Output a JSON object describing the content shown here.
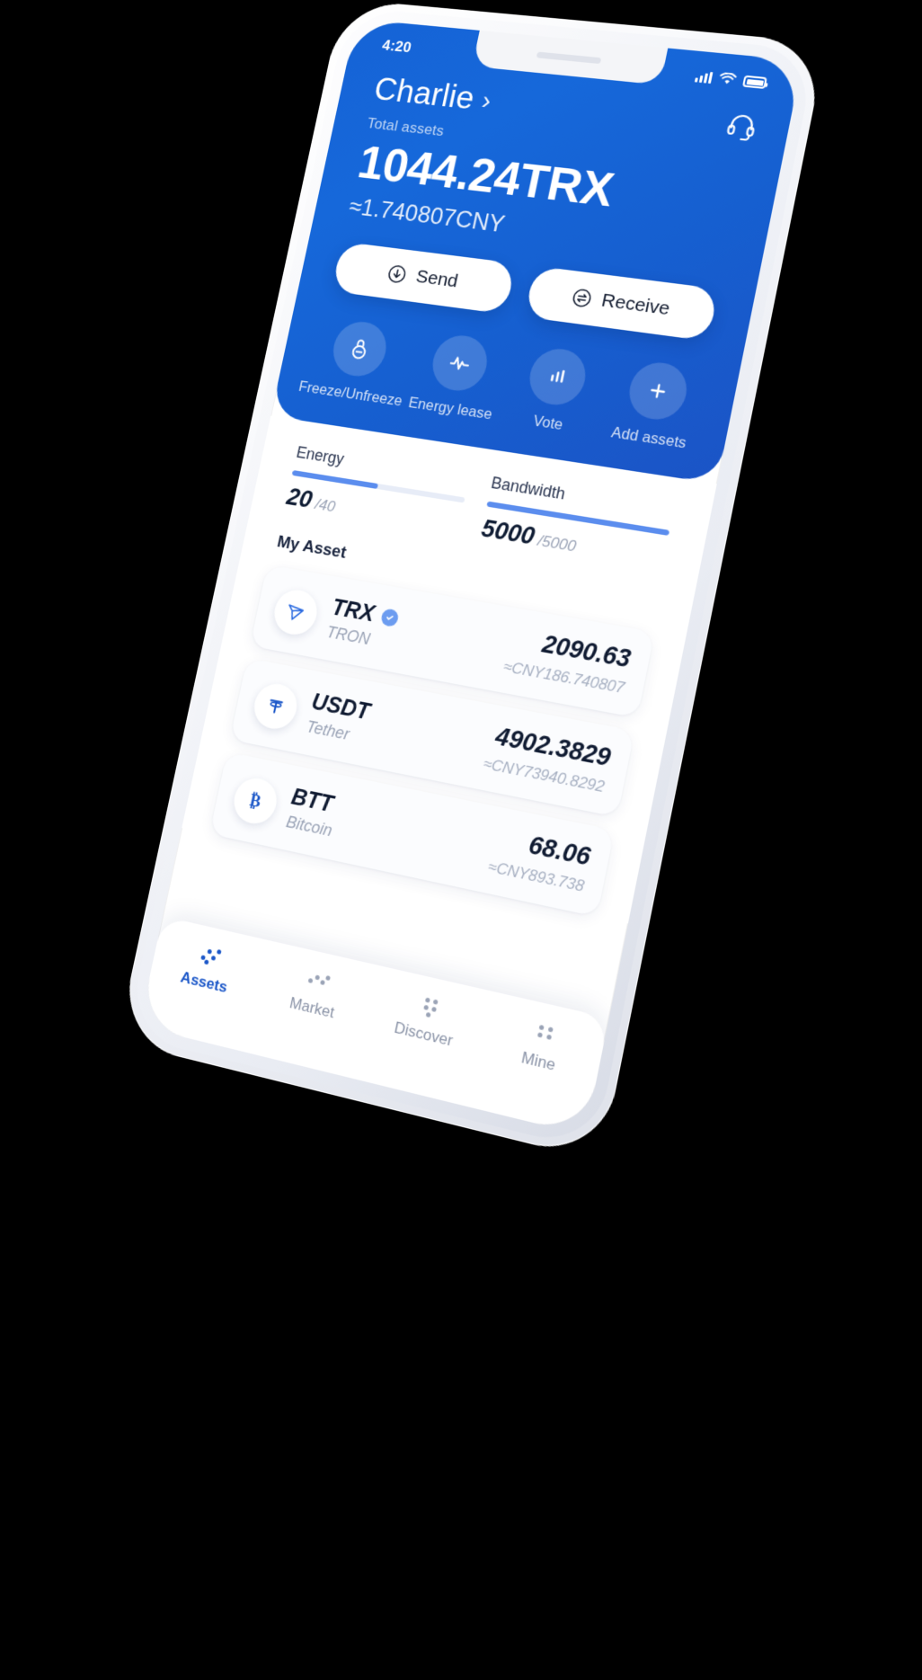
{
  "status_bar": {
    "time": "4:20",
    "signal_icon": "cellular-signal-icon",
    "wifi_icon": "wifi-icon",
    "battery_icon": "battery-icon"
  },
  "header": {
    "wallet_name": "Charlie",
    "chevron": "›",
    "total_label": "Total assets",
    "balance": "1044.24TRX",
    "balance_fiat": "≈1.740807CNY",
    "support_icon": "headset-support-icon",
    "accent_color": "#1668da"
  },
  "primary_actions": [
    {
      "label": "Send",
      "icon": "download-circle-icon"
    },
    {
      "label": "Receive",
      "icon": "exchange-circle-icon"
    }
  ],
  "quick_actions": [
    {
      "label": "Freeze/Unfreeze",
      "icon": "lock-minus-icon"
    },
    {
      "label": "Energy lease",
      "icon": "pulse-icon"
    },
    {
      "label": "Vote",
      "icon": "bar-chart-icon"
    },
    {
      "label": "Add assets",
      "icon": "plus-icon"
    }
  ],
  "resources": [
    {
      "name": "Energy",
      "current": "20",
      "max": "/40",
      "percent": 50
    },
    {
      "name": "Bandwidth",
      "current": "5000",
      "max": "/5000",
      "percent": 100
    }
  ],
  "assets": {
    "title": "My Asset",
    "items": [
      {
        "symbol": "TRX",
        "name": "TRON",
        "amount": "2090.63",
        "fiat": "≈CNY186.740807",
        "icon": "tron-logo-icon",
        "verified": true
      },
      {
        "symbol": "USDT",
        "name": "Tether",
        "amount": "4902.3829",
        "fiat": "≈CNY73940.8292",
        "icon": "tether-logo-icon",
        "verified": false
      },
      {
        "symbol": "BTT",
        "name": "Bitcoin",
        "amount": "68.06",
        "fiat": "≈CNY893.738",
        "icon": "bitcoin-logo-icon",
        "verified": false
      }
    ]
  },
  "tabbar": [
    {
      "label": "Assets",
      "icon": "assets-dots-icon",
      "active": true
    },
    {
      "label": "Market",
      "icon": "market-dots-icon",
      "active": false
    },
    {
      "label": "Discover",
      "icon": "discover-dots-icon",
      "active": false
    },
    {
      "label": "Mine",
      "icon": "mine-dots-icon",
      "active": false
    }
  ]
}
